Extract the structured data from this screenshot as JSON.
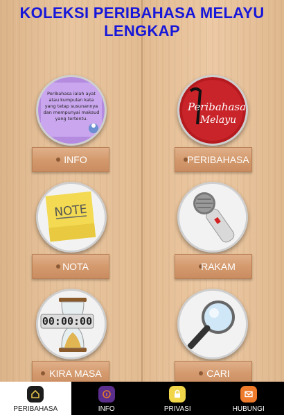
{
  "header": {
    "title_line1": "KOLEKSI PERIBAHASA MELAYU",
    "title_line2": "LENGKAP"
  },
  "tiles": [
    {
      "label": "INFO",
      "icon": "info-note-icon",
      "image_text": [
        "Peribahasa ialah ayat",
        "atau kumpulan kata",
        "yang tetap susunannya",
        "dan mempunyai maksud",
        "yang tertentu."
      ]
    },
    {
      "label": "PERIBAHASA",
      "icon": "peribahasa-logo-icon",
      "image_text": [
        "Peribahasa",
        "Melayu"
      ]
    },
    {
      "label": "NOTA",
      "icon": "sticky-note-icon",
      "image_text": [
        "NOTE"
      ]
    },
    {
      "label": "RAKAM",
      "icon": "microphone-icon"
    },
    {
      "label": "KIRA MASA",
      "icon": "hourglass-icon",
      "image_text": [
        "00:00:00"
      ]
    },
    {
      "label": "CARI",
      "icon": "magnifier-icon"
    }
  ],
  "tabbar": {
    "items": [
      {
        "label": "PERIBAHASA",
        "icon": "home-icon",
        "active": true,
        "color": "#1c1c1c"
      },
      {
        "label": "INFO",
        "icon": "info-icon",
        "active": false,
        "color": "#5b2d8c"
      },
      {
        "label": "PRIVASI",
        "icon": "lock-icon",
        "active": false,
        "color": "#f1d64a"
      },
      {
        "label": "HUBUNGI",
        "icon": "mail-icon",
        "active": false,
        "color": "#ee7a2b"
      }
    ]
  },
  "colors": {
    "title": "#1717d9",
    "button": "#d49a6e",
    "tabbar": "#000000"
  }
}
